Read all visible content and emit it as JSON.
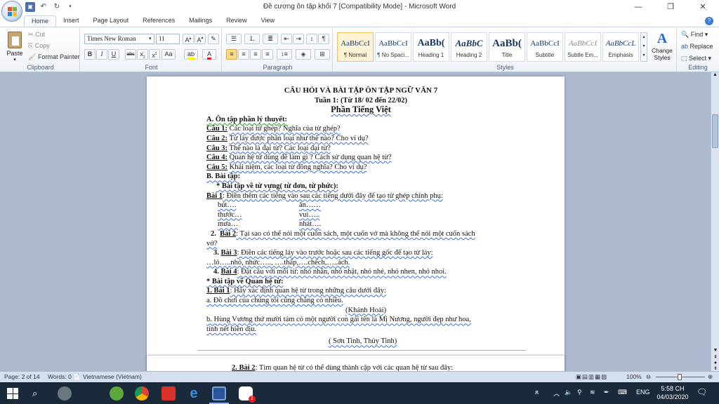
{
  "window": {
    "title": "Đề cương ôn tập khối 7 [Compatibility Mode] - Microsoft Word",
    "controls": [
      "—",
      "❐",
      "✕"
    ]
  },
  "tabs": [
    "Home",
    "Insert",
    "Page Layout",
    "References",
    "Mailings",
    "Review",
    "View"
  ],
  "active_tab": "Home",
  "clipboard": {
    "paste": "Paste",
    "cut": "Cut",
    "copy": "Copy",
    "format_painter": "Format Painter",
    "label": "Clipboard"
  },
  "font": {
    "name": "Times New Roman",
    "size": "11",
    "label": "Font"
  },
  "paragraph": {
    "label": "Paragraph"
  },
  "styles": {
    "label": "Styles",
    "items": [
      {
        "preview": "AaBbCcI",
        "name": "¶ Normal"
      },
      {
        "preview": "AaBbCcI",
        "name": "¶ No Spaci..."
      },
      {
        "preview": "AaBb(",
        "name": "Heading 1"
      },
      {
        "preview": "AaBbC",
        "name": "Heading 2"
      },
      {
        "preview": "AaBb(",
        "name": "Title"
      },
      {
        "preview": "AaBbCcI",
        "name": "Subtitle"
      },
      {
        "preview": "AaBbCcI",
        "name": "Subtle Em..."
      },
      {
        "preview": "AaBbCcL",
        "name": "Emphasis"
      }
    ],
    "change_styles": "Change Styles"
  },
  "editing": {
    "label": "Editing",
    "find": "Find",
    "replace": "Replace",
    "select": "Select"
  },
  "document": {
    "title1": "CÂU HỎI VÀ BÀI TẬP ÔN TẬP NGỮ VĂN 7",
    "title2": "Tuần 1: (Từ 18/ 02 đến 22/02)",
    "title3": "Phần Tiếng Việt",
    "a_head": "A. Ôn tập phần lý thuyết:",
    "q1_label": "Câu 1:",
    "q1": "Các loại từ ghép? Nghĩa của từ ghép?",
    "q2_label": "Câu 2:",
    "q2": "Từ láy được phân loại như thế nào? Cho ví dụ?",
    "q3_label": "Câu 3:",
    "q3": "Thế nào là đại từ? Các loại đại từ?",
    "q4_label": "Câu 4:",
    "q4": "Quan hệ từ dùng để làm gì ? Cách sử dụng quan hệ từ?",
    "q5_label": "Câu 5:",
    "q5": "Khái niệm, các loại từ đồng nghĩa? Cho ví dụ?",
    "b_head": "B. Bài tập",
    "b_sub": "* Bài tập về từ vựng( từ đơn, từ phức):",
    "ex1_label": "Bài 1",
    "ex1": ": Điền thêm các tiếng vào sau các tiếng dưới đây để tạo từ ghép chính phụ:",
    "ex1_rows": [
      {
        "left": "bút….",
        "right": "ăn……"
      },
      {
        "left": "thước…",
        "right": "vui….."
      },
      {
        "left": "mưa…",
        "right": "nhát…."
      }
    ],
    "ex2_num": "2.",
    "ex2_label": "Bài 2",
    "ex2": ": Tại sao có thể nói một cuốn sách, một cuốn vở mà không thể nói một cuốn sách",
    "ex2_cont": "vở?",
    "ex3_num": "3.",
    "ex3_label": "Bài 3",
    "ex3": ": Điền các tiếng láy vào trước hoặc sau các tiếng gốc để tạo từ láy:",
    "ex3_items": "…ló…..nhỏ, nhức….., ….thấp,….chếch,…..ách.",
    "ex4_num": "4.",
    "ex4_label": "Bài 4",
    "ex4": ": Đặt câu với mỗi từ: nhỏ nhắn, nhỏ nhặt, nhỏ nhẻ, nhỏ nhen, nhỏ nhoi.",
    "qh_head": "* Bài tập về Quan hệ từ:",
    "qh1_label": "1. Bài 1",
    "qh1": ": Hãy xác định quan hệ từ trong những câu dưới đây:",
    "qh1_a": "a. Đồ chơi của chúng tôi cũng chẳng có nhiều.",
    "qh1_a_src": "(Khánh Hoài)",
    "qh1_b": "b. Hùng Vương thứ mười tám có một người con gái tên là Mị Nương, người đẹp như hoa,",
    "qh1_b_cont": "tính nết hiền dịu.",
    "qh1_b_src": "( Sơn Tinh, Thủy Tinh)",
    "qh2_label": "2. Bài 2",
    "qh2": ": Tìm quan hệ từ có thể dùng thành cặp với các quan hệ từ sau đây:"
  },
  "status": {
    "page": "Page: 2 of 14",
    "words": "Words: 0",
    "language": "Vietnamese (Vietnam)",
    "zoom": "100%"
  },
  "tray": {
    "time": "5:58 CH",
    "date": "04/03/2020",
    "lang": "ENG",
    "notification_badge": "1"
  },
  "colors": {
    "ribbon_bg": "#eef2f8",
    "workspace_bg": "#adb9cd",
    "taskbar_bg": "#1b2a3a",
    "accent": "#1e395b"
  }
}
